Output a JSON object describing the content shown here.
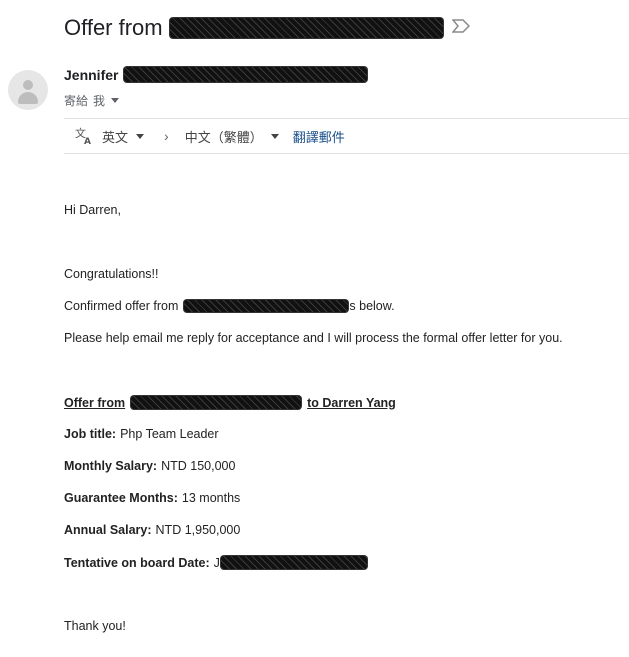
{
  "header": {
    "subject_prefix": "Offer from",
    "label_icon": "label-arrow-icon"
  },
  "sender": {
    "name": "Jennifer",
    "recipient_prefix": "寄給",
    "recipient": "我"
  },
  "translate_bar": {
    "icon": "translate-icon",
    "from_lang": "英文",
    "to_lang": "中文（繁體）",
    "action": "翻譯郵件"
  },
  "body": {
    "greeting": "Hi Darren,",
    "congrats": "Congratulations!!",
    "confirmed_prefix": "Confirmed offer from",
    "confirmed_suffix": "s below.",
    "request": "Please help email me reply for acceptance and I will process the formal offer letter for you.",
    "offer_heading_prefix": "Offer from",
    "offer_heading_suffix": "to Darren Yang",
    "job_title_label": "Job title:",
    "job_title_value": "Php Team Leader",
    "monthly_label": "Monthly Salary:",
    "monthly_value": "NTD 150,000",
    "guarantee_label": "Guarantee Months:",
    "guarantee_value": "13 months",
    "annual_label": "Annual Salary:",
    "annual_value": "NTD 1,950,000",
    "onboard_label": "Tentative on board Date:",
    "onboard_value_prefix": "J",
    "closing": "Thank you!"
  }
}
